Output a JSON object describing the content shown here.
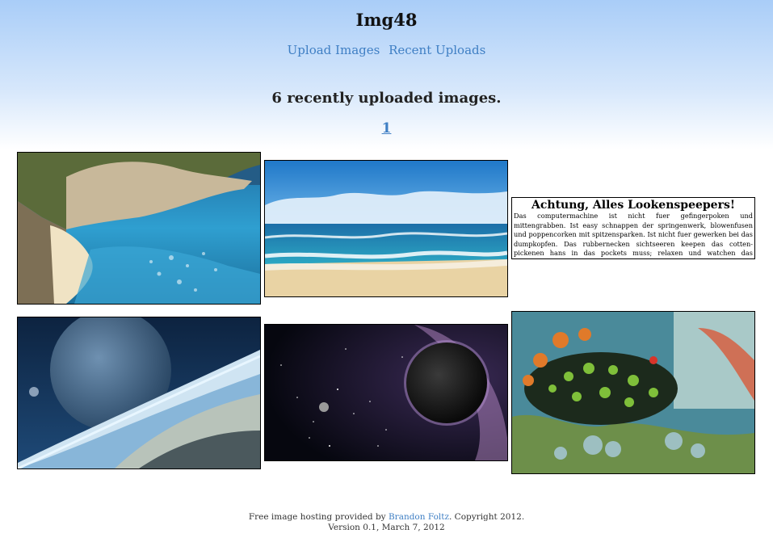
{
  "site": {
    "title": "Img48"
  },
  "nav": {
    "upload": "Upload Images",
    "recent": "Recent Uploads"
  },
  "main": {
    "heading": "6 recently uploaded images.",
    "pages": [
      "1"
    ]
  },
  "images": [
    {
      "subject": "beach cove with cliffs"
    },
    {
      "subject": "ocean waves under blue sky"
    },
    {
      "subject": "blackletter warning sign",
      "title": "Achtung, Alles Lookenspeepers!",
      "body": "Das computermachine ist nicht fuer gefingerpoken und mittengrabben. Ist easy schnappen der springenwerk, blowenfusen und poppencorken mit spitzensparken. Ist nicht fuer gewerken bei das dumpkopfen. Das rubbernecken sichtseeren keepen das cotten-pickenen hans in das pockets muss; relaxen und watchen das blinkenlichten."
    },
    {
      "subject": "planet over clouds"
    },
    {
      "subject": "dark planet in space"
    },
    {
      "subject": "sea slug on coral reef"
    }
  ],
  "footer": {
    "prefix": "Free image hosting provided by ",
    "author": "Brandon Foltz",
    "suffix": ". Copyright 2012.",
    "version": "Version 0.1, March 7, 2012"
  }
}
